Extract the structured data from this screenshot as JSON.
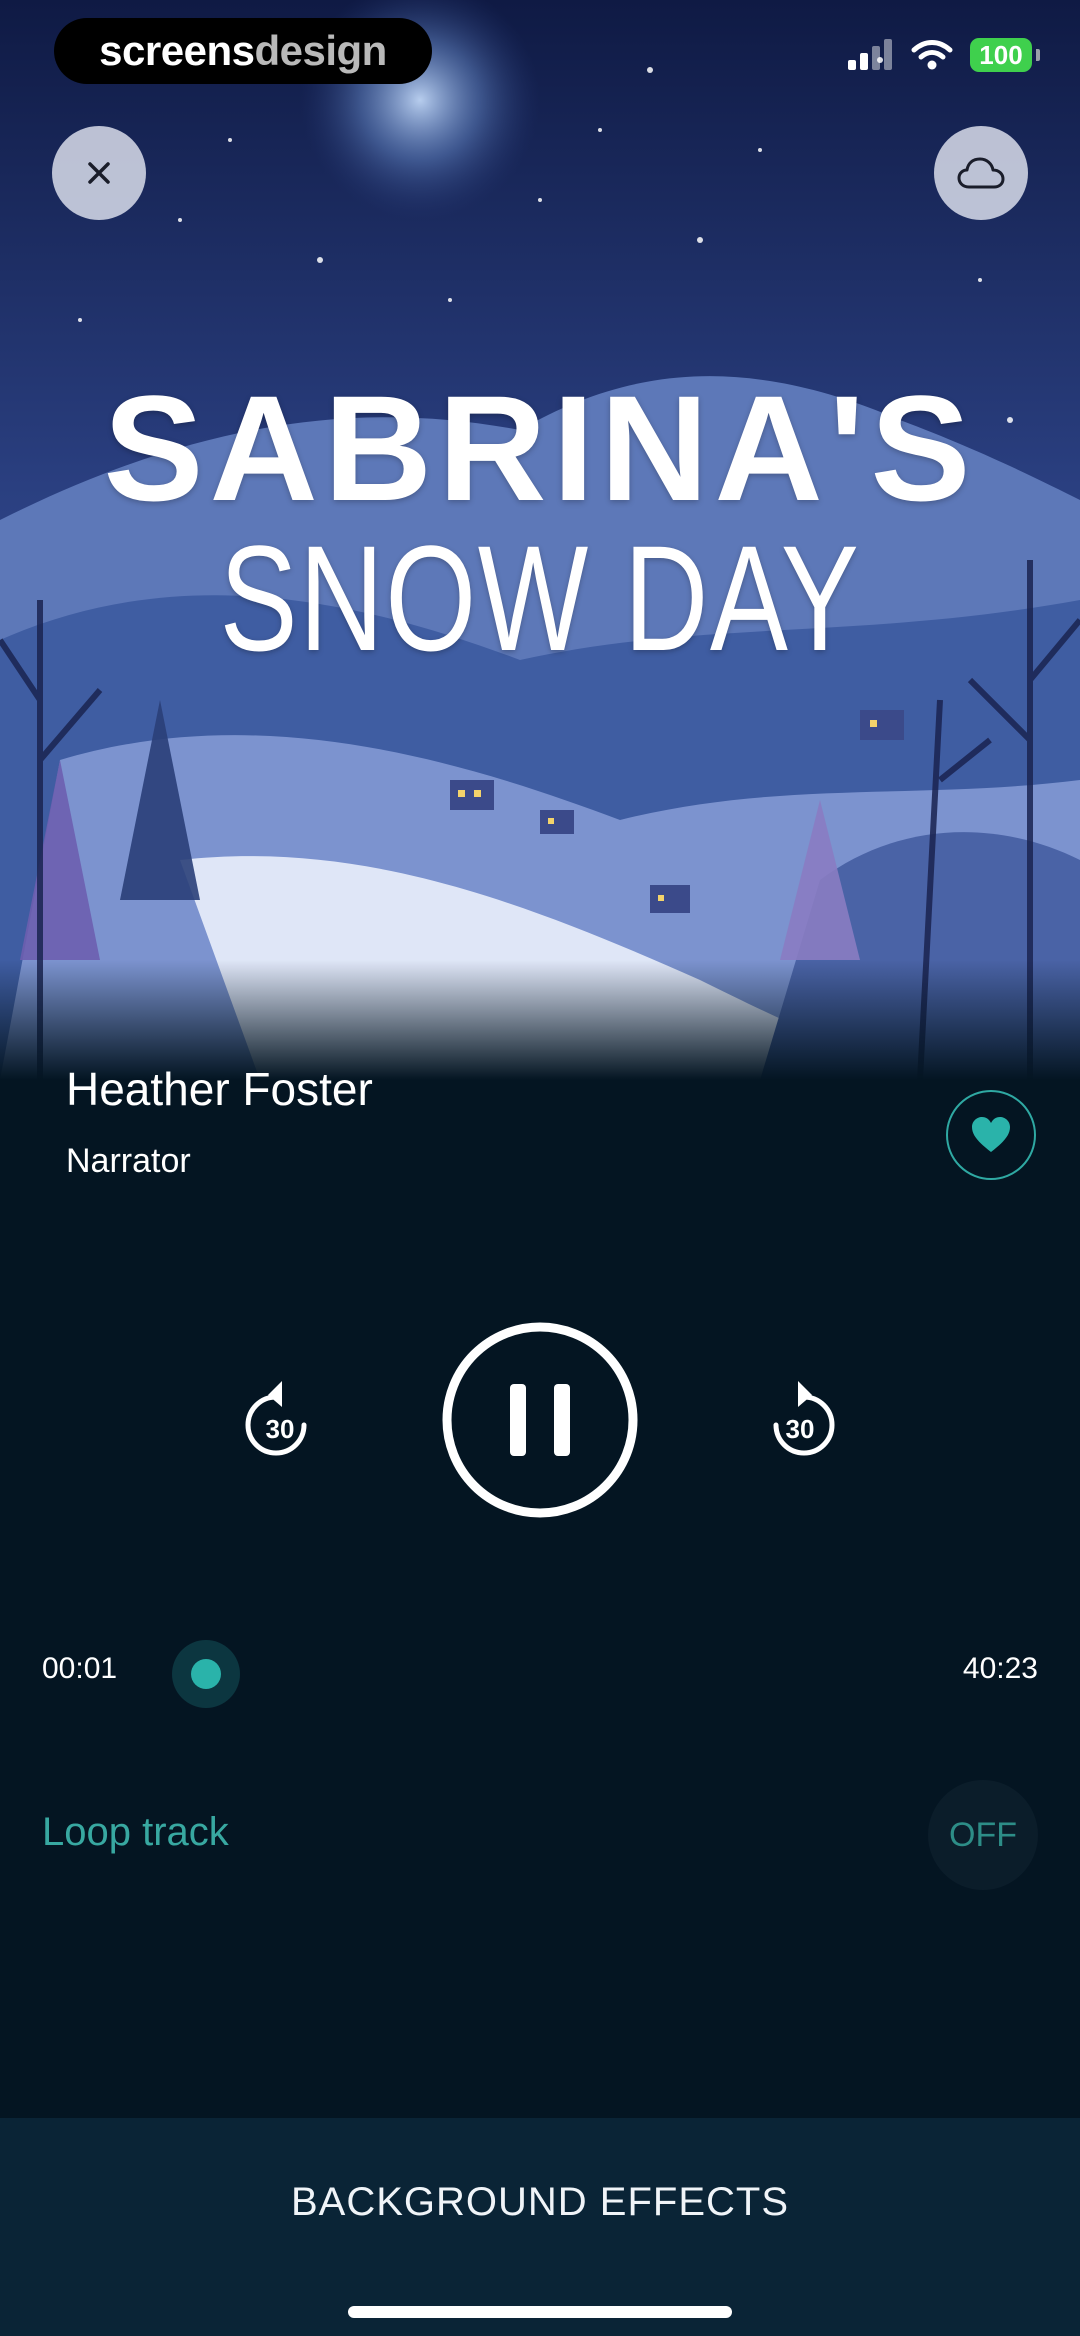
{
  "status_bar": {
    "brand_part1": "screens",
    "brand_part2": "design",
    "battery": "100"
  },
  "story": {
    "title_line1": "SABRINA'S",
    "title_line2": "SNOW DAY"
  },
  "icons": {
    "close": "close-icon",
    "cloud": "cloud-icon",
    "heart": "heart-icon",
    "skip_back": "rewind-30-icon",
    "pause": "pause-icon",
    "skip_forward": "forward-30-icon"
  },
  "narrator": {
    "name": "Heather Foster",
    "role": "Narrator"
  },
  "controls": {
    "skip_back_label": "30",
    "skip_forward_label": "30"
  },
  "progress": {
    "current": "00:01",
    "total": "40:23"
  },
  "loop": {
    "label": "Loop track",
    "state": "OFF"
  },
  "bottom": {
    "background_effects": "BACKGROUND EFFECTS"
  },
  "colors": {
    "background": "#041522",
    "accent": "#2ab3aa",
    "bottom_bar": "#0a2436"
  }
}
